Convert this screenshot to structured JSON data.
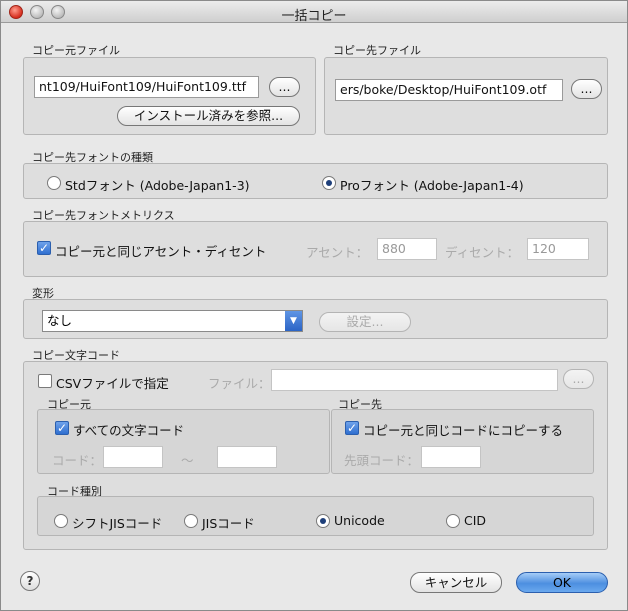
{
  "window": {
    "title": "一括コピー"
  },
  "source_file": {
    "label": "コピー元ファイル",
    "path": "nt109/HuiFont109/HuiFont109.ttf",
    "browse": "...",
    "installed_button": "インストール済みを参照..."
  },
  "dest_file": {
    "label": "コピー先ファイル",
    "path": "ers/boke/Desktop/HuiFont109.otf",
    "browse": "..."
  },
  "font_type": {
    "label": "コピー先フォントの種類",
    "std_label": "Stdフォント (Adobe-Japan1-3)",
    "pro_label": "Proフォント (Adobe-Japan1-4)",
    "selected": "pro"
  },
  "metrics": {
    "label": "コピー先フォントメトリクス",
    "same_label": "コピー元と同じアセント・ディセント",
    "same_checked": true,
    "ascent_label": "アセント：",
    "ascent_value": "880",
    "descent_label": "ディセント：",
    "descent_value": "120"
  },
  "transform": {
    "label": "変形",
    "selected": "なし",
    "settings_button": "設定..."
  },
  "char_code": {
    "label": "コピー文字コード",
    "csv_label": "CSVファイルで指定",
    "csv_checked": false,
    "file_label": "ファイル：",
    "file_value": "",
    "browse": "...",
    "source": {
      "label": "コピー元",
      "all_label": "すべての文字コード",
      "all_checked": true,
      "code_label": "コード：",
      "from": "",
      "tilde": "〜",
      "to": ""
    },
    "dest": {
      "label": "コピー先",
      "same_label": "コピー元と同じコードにコピーする",
      "same_checked": true,
      "start_label": "先頭コード：",
      "start_value": ""
    },
    "code_type": {
      "label": "コード種別",
      "options": [
        "シフトJISコード",
        "JISコード",
        "Unicode",
        "CID"
      ],
      "selected": "Unicode"
    }
  },
  "buttons": {
    "help": "?",
    "cancel": "キャンセル",
    "ok": "OK"
  }
}
